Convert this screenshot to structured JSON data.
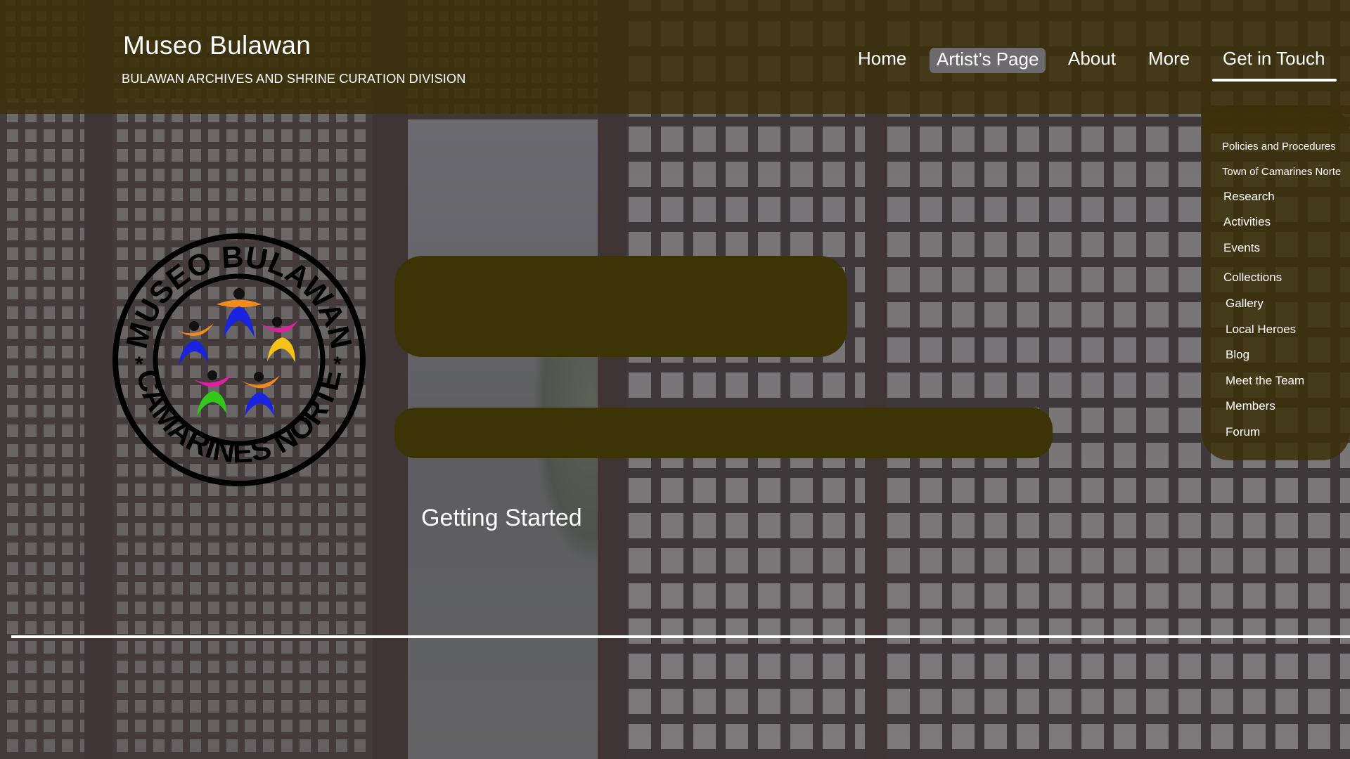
{
  "site": {
    "title": "Museo Bulawan",
    "subtitle": "BULAWAN ARCHIVES AND SHRINE CURATION DIVISION"
  },
  "nav": {
    "home": "Home",
    "artists_page": "Artist’s Page",
    "about": "About",
    "more": "More",
    "get_in_touch": "Get in Touch",
    "active": "Get in Touch",
    "highlighted": "Artist’s Page"
  },
  "dropdown": {
    "items": [
      "Policies and Procedures",
      "Town of Camarines Norte",
      "Research",
      "Activities",
      "Events",
      "Collections",
      "Gallery",
      "Local Heroes",
      "Blog",
      "Meet the Team",
      "Members",
      "Forum"
    ]
  },
  "logo": {
    "top_text": "MUSEO BULAWAN",
    "bottom_text": "CAMARINES NORTE",
    "separator": "*"
  },
  "main": {
    "getting_started": "Getting Started"
  },
  "colors": {
    "header_bg": "#3a3008",
    "block_bg": "#3c3306",
    "highlight_bg": "#6d6b6e",
    "text": "#ffffff"
  }
}
